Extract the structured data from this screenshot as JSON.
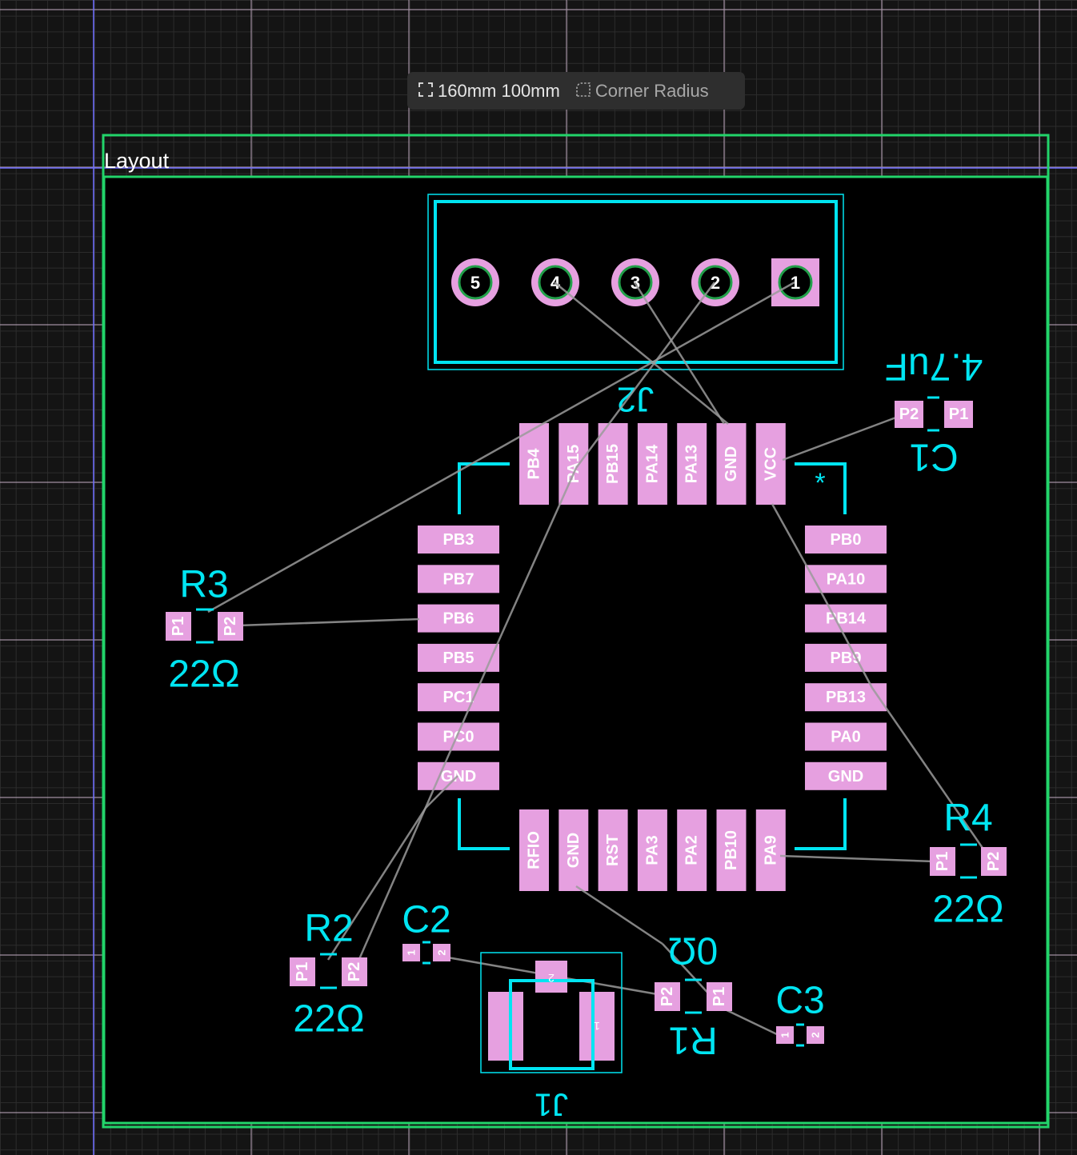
{
  "toolbar": {
    "size_value": "160mm 100mm",
    "size_icon": "expand-corners-icon",
    "corner_label": "Corner Radius",
    "corner_icon": "corner-radius-icon"
  },
  "board": {
    "label": "Layout"
  },
  "colors": {
    "background": "#141414",
    "grid_minor": "#2c2c2c",
    "grid_major": "#b9a4b9",
    "board_outline": "#22d46a",
    "silkscreen": "#00e5f2",
    "pad": "#e6a0e0",
    "ratsnest": "#9a9a9a",
    "guide": "#6c6cff"
  },
  "components": {
    "J2": {
      "ref": "J2",
      "pins": [
        "5",
        "4",
        "3",
        "2",
        "1"
      ]
    },
    "U1": {
      "top_pins": [
        "PB4",
        "PA15",
        "PB15",
        "PA14",
        "PA13",
        "GND",
        "VCC"
      ],
      "left_pins": [
        "PB3",
        "PB7",
        "PB6",
        "PB5",
        "PC1",
        "PC0",
        "GND"
      ],
      "right_pins": [
        "PB0",
        "PA10",
        "PB14",
        "PB9",
        "PB13",
        "PA0",
        "GND"
      ],
      "bottom_pins": [
        "RFIO",
        "GND",
        "RST",
        "PA3",
        "PA2",
        "PB10",
        "PA9"
      ],
      "pin1_marker": "*"
    },
    "C1": {
      "ref": "C1",
      "value": "4.7uF",
      "pads": [
        "P2",
        "P1"
      ]
    },
    "R3": {
      "ref": "R3",
      "value": "22Ω",
      "pads": [
        "P1",
        "P2"
      ]
    },
    "R4": {
      "ref": "R4",
      "value": "22Ω",
      "pads": [
        "P1",
        "P2"
      ]
    },
    "R2": {
      "ref": "R2",
      "value": "22Ω",
      "pads": [
        "P1",
        "P2"
      ]
    },
    "C2": {
      "ref": "C2",
      "pads": [
        "1",
        "2"
      ]
    },
    "R1": {
      "ref": "R1",
      "value": "0Ω",
      "pads": [
        "P2",
        "P1"
      ]
    },
    "C3": {
      "ref": "C3",
      "pads": [
        "1",
        "2"
      ]
    },
    "J1": {
      "ref": "J1",
      "pads": [
        "1",
        "2"
      ]
    }
  }
}
